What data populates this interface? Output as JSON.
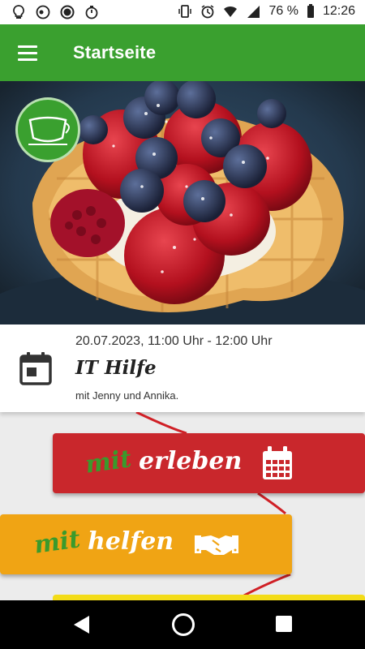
{
  "status_bar": {
    "battery_percent": "76 %",
    "time": "12:26",
    "left_icons": [
      "bulb-icon",
      "record-icon",
      "circle-icon",
      "stopwatch-icon"
    ],
    "right_icons": [
      "vibrate-icon",
      "alarm-icon",
      "wifi-icon",
      "signal-icon",
      "battery-icon"
    ]
  },
  "app_bar": {
    "title": "Startseite",
    "menu_icon": "hamburger-menu-icon",
    "color": "#3aa02f"
  },
  "hero": {
    "image": "waffle with strawberries, raspberries and blueberries",
    "logo_icon": "cafe-logo-icon"
  },
  "event": {
    "date_time": "20.07.2023, 11:00 Uhr - 12:00 Uhr",
    "title": "IT Hilfe",
    "subtitle": "mit Jenny und Annika.",
    "icon": "calendar-icon"
  },
  "actions": [
    {
      "prefix": "mit",
      "word": "erleben",
      "icon": "calendar-grid-icon",
      "color": "#c9272c"
    },
    {
      "prefix": "mit",
      "word": "helfen",
      "icon": "handshake-icon",
      "color": "#f0a414"
    },
    {
      "color": "#f3dc18"
    }
  ],
  "nav_bar": {
    "icons": [
      "back-icon",
      "home-icon",
      "recents-icon"
    ]
  }
}
